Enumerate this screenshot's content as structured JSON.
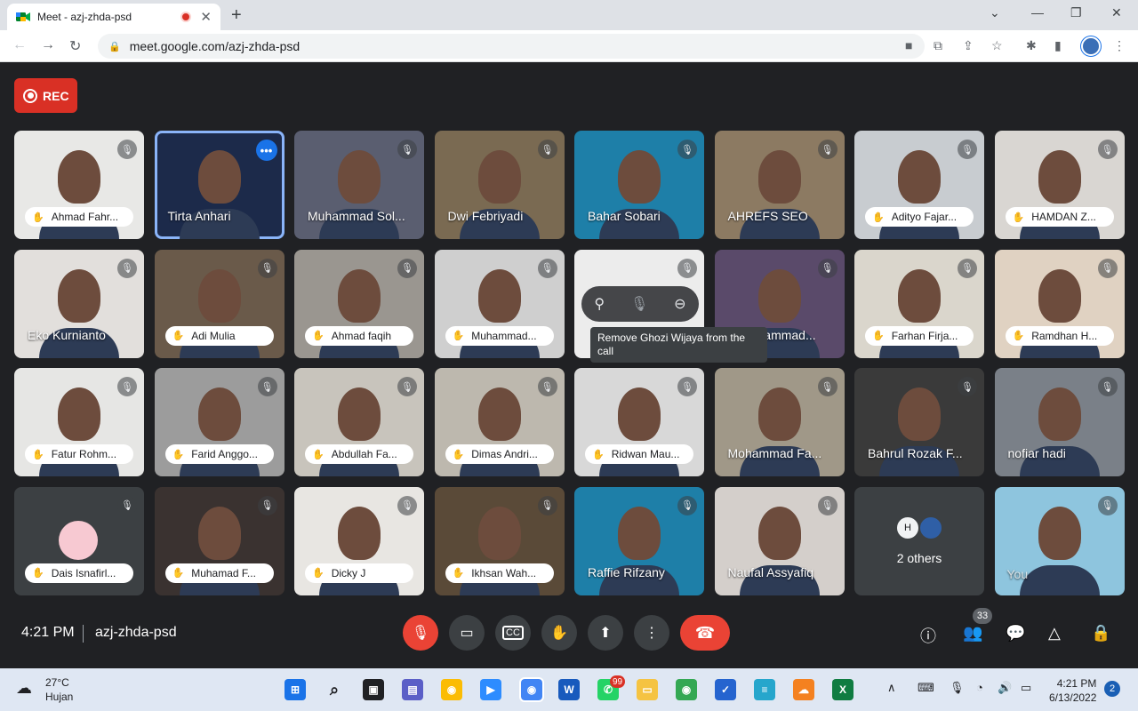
{
  "browser": {
    "tab_title": "Meet - azj-zhda-psd",
    "close_tab": "✕",
    "new_tab": "+",
    "url": "meet.google.com/azj-zhda-psd"
  },
  "meet": {
    "rec_label": "REC",
    "tooltip": "Remove Ghozi Wijaya from the call",
    "participants": [
      {
        "name": "Ahmad Fahr...",
        "hand": true
      },
      {
        "name": "Tirta Anhari",
        "hand": false
      },
      {
        "name": "Muhammad Sol...",
        "hand": false
      },
      {
        "name": "Dwi Febriyadi",
        "hand": false
      },
      {
        "name": "Bahar Sobari",
        "hand": false
      },
      {
        "name": "AHREFS SEO",
        "hand": false
      },
      {
        "name": "Adityo Fajar...",
        "hand": true
      },
      {
        "name": "HAMDAN Z...",
        "hand": true
      },
      {
        "name": "Eko Kurnianto",
        "hand": false
      },
      {
        "name": "Adi Mulia",
        "hand": true
      },
      {
        "name": "Ahmad faqih",
        "hand": true
      },
      {
        "name": "Muhammad...",
        "hand": true
      },
      {
        "name": "",
        "hand": false
      },
      {
        "name": "hammad...",
        "hand": false
      },
      {
        "name": "Farhan Firja...",
        "hand": true
      },
      {
        "name": "Ramdhan H...",
        "hand": true
      },
      {
        "name": "Fatur Rohm...",
        "hand": true
      },
      {
        "name": "Farid Anggo...",
        "hand": true
      },
      {
        "name": "Abdullah Fa...",
        "hand": true
      },
      {
        "name": "Dimas Andri...",
        "hand": true
      },
      {
        "name": "Ridwan Mau...",
        "hand": true
      },
      {
        "name": "Mohammad Fa...",
        "hand": false
      },
      {
        "name": "Bahrul Rozak F...",
        "hand": false
      },
      {
        "name": "nofiar hadi",
        "hand": false
      },
      {
        "name": "Dais Isnafirl...",
        "hand": true
      },
      {
        "name": "Muhamad F...",
        "hand": true
      },
      {
        "name": "Dicky J",
        "hand": true
      },
      {
        "name": "Ikhsan Wah...",
        "hand": true
      },
      {
        "name": "Raffie Rifzany",
        "hand": false
      },
      {
        "name": "Naufal Assyafiq",
        "hand": false
      },
      {
        "name": "2 others",
        "hand": false
      },
      {
        "name": "You",
        "hand": false
      }
    ],
    "others_initials": "H",
    "time": "4:21 PM",
    "meeting_code": "azj-zhda-psd",
    "people_count": "33"
  },
  "taskbar": {
    "temp": "27°C",
    "weather": "Hujan",
    "whatsapp_badge": "99",
    "time": "4:21 PM",
    "date": "6/13/2022",
    "notifications": "2"
  }
}
